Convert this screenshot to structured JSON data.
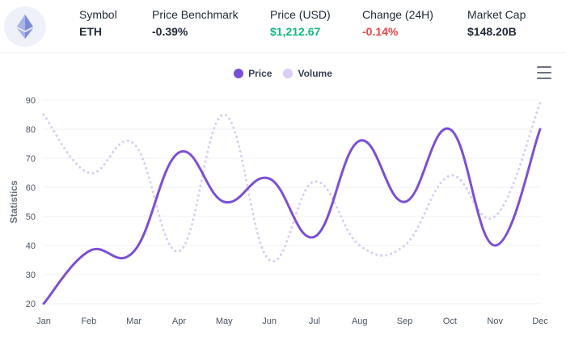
{
  "header": {
    "coin_icon": "ethereum-icon",
    "stats": [
      {
        "label": "Symbol",
        "value": "ETH",
        "color": "#1f2937"
      },
      {
        "label": "Price Benchmark",
        "value": "-0.39%",
        "color": "#1f2937"
      },
      {
        "label": "Price (USD)",
        "value": "$1,212.67",
        "color": "#10b981"
      },
      {
        "label": "Change (24H)",
        "value": "-0.14%",
        "color": "#ef4444"
      },
      {
        "label": "Market Cap",
        "value": "$148.20B",
        "color": "#1f2937"
      }
    ]
  },
  "toolbar": {
    "menu_icon": "hamburger-menu-icon"
  },
  "chart_data": {
    "type": "line",
    "categories": [
      "Jan",
      "Feb",
      "Mar",
      "Apr",
      "May",
      "Jun",
      "Jul",
      "Aug",
      "Sep",
      "Oct",
      "Nov",
      "Dec"
    ],
    "series": [
      {
        "name": "Price",
        "values": [
          20,
          38,
          38,
          72,
          55,
          63,
          43,
          76,
          55,
          80,
          40,
          80
        ],
        "color": "#7b4fd6",
        "style": "solid"
      },
      {
        "name": "Volume",
        "values": [
          85,
          65,
          75,
          38,
          85,
          35,
          62,
          40,
          40,
          64,
          50,
          89
        ],
        "color": "#d9ccf5",
        "style": "dotted"
      }
    ],
    "ylabel": "Statistics",
    "xlabel": "",
    "ylim": [
      20,
      90
    ],
    "yticks": [
      20,
      30,
      40,
      50,
      60,
      70,
      80,
      90
    ],
    "grid": true,
    "curve": "smooth",
    "legend_position": "top-center"
  }
}
